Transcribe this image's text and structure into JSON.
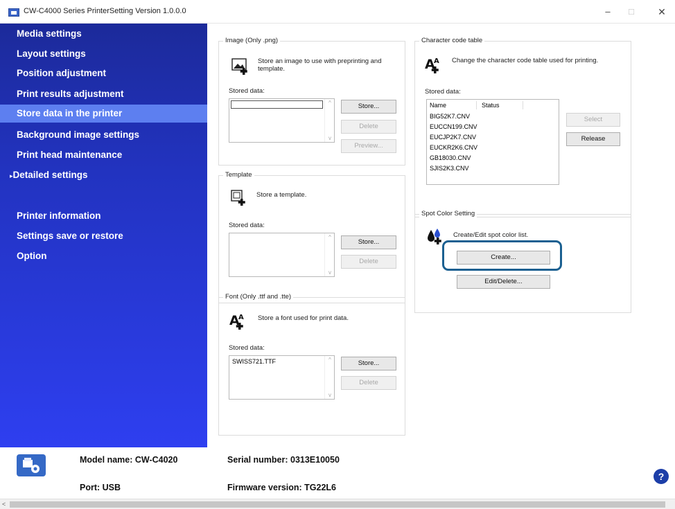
{
  "window": {
    "title": "CW-C4000 Series PrinterSetting Version 1.0.0.0",
    "minimize": "–",
    "maximize": "□",
    "close": "✕"
  },
  "sidebar": {
    "items": [
      {
        "label": "Media settings"
      },
      {
        "label": "Layout settings"
      },
      {
        "label": "Position adjustment"
      },
      {
        "label": "Print results adjustment"
      },
      {
        "label": "Store data in the printer",
        "selected": true
      },
      {
        "label": "Background image settings"
      },
      {
        "label": "Print head maintenance"
      },
      {
        "label": "Detailed settings",
        "expander": "▸"
      },
      {
        "label": "Printer information"
      },
      {
        "label": "Settings save or restore"
      },
      {
        "label": "Option"
      }
    ]
  },
  "image_group": {
    "title": "Image (Only .png)",
    "description": "Store an image to use with preprinting and template.",
    "stored_label": "Stored data:",
    "store": "Store...",
    "delete": "Delete",
    "preview": "Preview..."
  },
  "template_group": {
    "title": "Template",
    "description": "Store a template.",
    "stored_label": "Stored data:",
    "store": "Store...",
    "delete": "Delete"
  },
  "font_group": {
    "title": "Font (Only .ttf and .tte)",
    "description": "Store a font used for print data.",
    "stored_label": "Stored data:",
    "items": [
      "SWISS721.TTF"
    ],
    "store": "Store...",
    "delete": "Delete"
  },
  "charcode_group": {
    "title": "Character code table",
    "description": "Change the character code table used for printing.",
    "stored_label": "Stored data:",
    "columns": [
      "Name",
      "Status"
    ],
    "rows": [
      "BIG52K7.CNV",
      "EUCCN199.CNV",
      "EUCJP2K7.CNV",
      "EUCKR2K6.CNV",
      "GB18030.CNV",
      "SJIS2K3.CNV"
    ],
    "select": "Select",
    "release": "Release"
  },
  "spot_group": {
    "title": "Spot Color Setting",
    "description": "Create/Edit spot color list.",
    "create": "Create...",
    "edit_delete": "Edit/Delete..."
  },
  "footer": {
    "model": "Model name: CW-C4020",
    "serial": "Serial number: 0313E10050",
    "port": "Port: USB",
    "firmware": "Firmware version: TG22L6",
    "help": "?"
  },
  "colors": {
    "sidebar_top": "#1c2a9a",
    "sidebar_bottom": "#2e3ff0",
    "sidebar_selected": "#5d7ff0",
    "highlight": "#1b6091"
  }
}
